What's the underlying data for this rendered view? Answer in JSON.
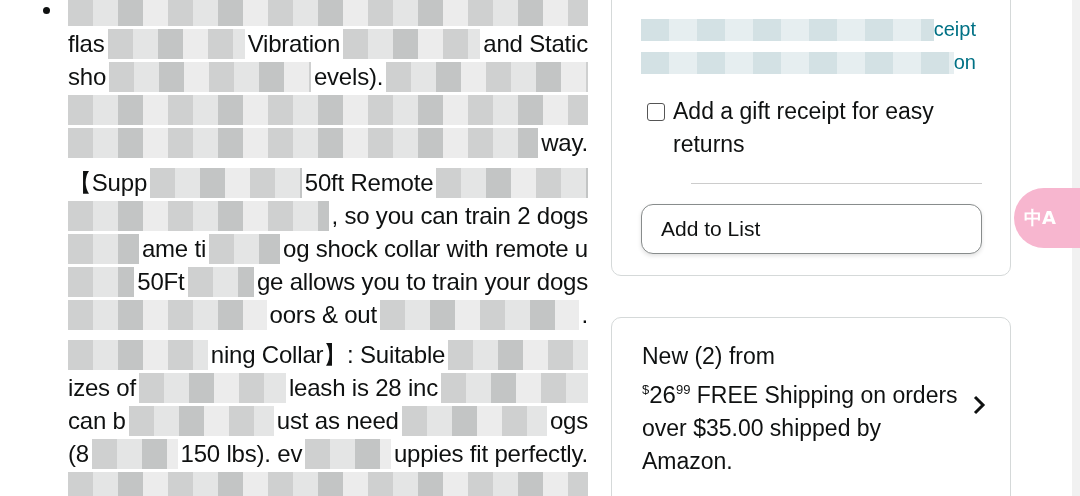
{
  "description": {
    "paragraphs": [
      {
        "bullet": true,
        "lines": [
          [
            {
              "kind": "redacted"
            }
          ],
          [
            {
              "kind": "text",
              "text": "flas"
            },
            {
              "kind": "redacted"
            },
            {
              "kind": "text",
              "text": "Vibration"
            },
            {
              "kind": "redacted"
            },
            {
              "kind": "text",
              "text": "and Static"
            }
          ],
          [
            {
              "kind": "text",
              "text": "sho"
            },
            {
              "kind": "redacted"
            },
            {
              "kind": "text",
              "text": "evels)."
            },
            {
              "kind": "redacted"
            }
          ],
          [
            {
              "kind": "redacted"
            }
          ],
          [
            {
              "kind": "redacted"
            },
            {
              "kind": "text",
              "text": "way."
            }
          ]
        ]
      },
      {
        "bullet": false,
        "lines": [
          [
            {
              "kind": "text",
              "text": "【Supp"
            },
            {
              "kind": "redacted"
            },
            {
              "kind": "text",
              "text": "50ft Remote"
            },
            {
              "kind": "redacted"
            }
          ],
          [
            {
              "kind": "redacted"
            },
            {
              "kind": "text",
              "text": ", so you can train 2 dogs"
            }
          ],
          [
            {
              "kind": "redacted"
            },
            {
              "kind": "text",
              "text": "ame ti"
            },
            {
              "kind": "redacted"
            },
            {
              "kind": "text",
              "text": "og shock collar with remote u"
            }
          ],
          [
            {
              "kind": "redacted"
            },
            {
              "kind": "text",
              "text": "50Ft"
            },
            {
              "kind": "redacted"
            },
            {
              "kind": "text",
              "text": "ge allows you to train your dogs"
            }
          ],
          [
            {
              "kind": "redacted"
            },
            {
              "kind": "text",
              "text": "oors & out"
            },
            {
              "kind": "redacted"
            },
            {
              "kind": "text",
              "text": "."
            }
          ]
        ]
      },
      {
        "bullet": false,
        "lines": [
          [
            {
              "kind": "redacted"
            },
            {
              "kind": "text",
              "text": "ning Collar】: Suitable"
            },
            {
              "kind": "redacted"
            }
          ],
          [
            {
              "kind": "text",
              "text": "izes of"
            },
            {
              "kind": "redacted"
            },
            {
              "kind": "text",
              "text": "leash is 28 inc"
            },
            {
              "kind": "redacted"
            }
          ],
          [
            {
              "kind": "text",
              "text": "can b"
            },
            {
              "kind": "redacted"
            },
            {
              "kind": "text",
              "text": "ust as need"
            },
            {
              "kind": "redacted"
            },
            {
              "kind": "text",
              "text": "ogs"
            }
          ],
          [
            {
              "kind": "text",
              "text": "(8"
            },
            {
              "kind": "redacted"
            },
            {
              "kind": "text",
              "text": "150 lbs). ev"
            },
            {
              "kind": "redacted"
            },
            {
              "kind": "text",
              "text": "uppies fit perfectly."
            }
          ],
          [
            {
              "kind": "redacted"
            }
          ]
        ]
      }
    ]
  },
  "buy_box": {
    "return_lines": [
      [
        {
          "kind": "redacted"
        },
        {
          "kind": "text",
          "text": "ceipt"
        }
      ],
      [
        {
          "kind": "redacted"
        },
        {
          "kind": "text",
          "text": "on"
        }
      ]
    ],
    "gift_receipt": {
      "label": "Add a gift receipt for easy returns",
      "checked": false
    },
    "add_to_list": "Add to List"
  },
  "translate_button": {
    "label": "中A"
  },
  "offers": {
    "heading": "New (2) from",
    "price": {
      "symbol": "$",
      "whole": "26",
      "fraction": "99"
    },
    "shipping": "FREE Shipping on orders over $35.00 shipped by Amazon."
  }
}
